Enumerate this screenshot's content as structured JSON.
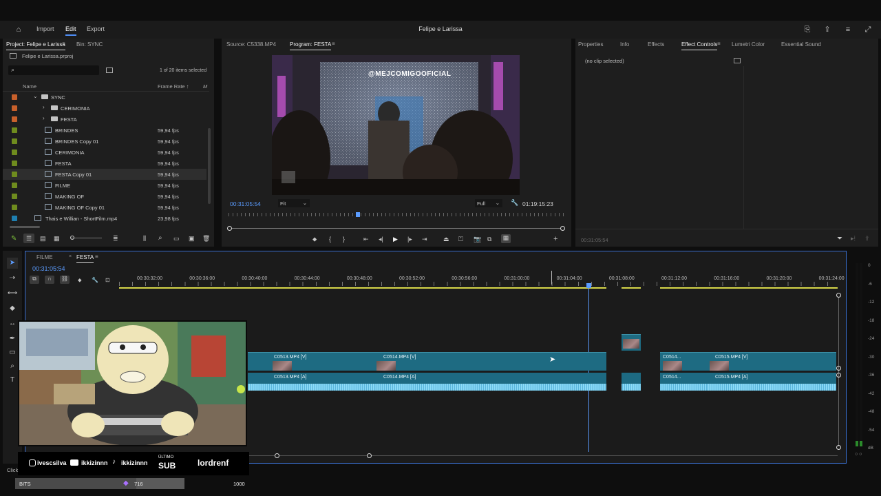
{
  "app": {
    "title": "Felipe e Larissa",
    "menu": [
      "Import",
      "Edit",
      "Export"
    ],
    "active_menu": "Edit"
  },
  "project": {
    "tabs": [
      "Project: Felipe e Larissa",
      "Bin: SYNC"
    ],
    "file": "Felipe e Larissa.prproj",
    "items_selected": "1 of 20 items selected",
    "col_name": "Name",
    "col_framerate": "Frame Rate",
    "col_more": "M",
    "rows": [
      {
        "label": "SYNC",
        "type": "folder",
        "indent": 1,
        "color": "#c8602b",
        "fps": ""
      },
      {
        "label": "CERIMONIA",
        "type": "folder",
        "indent": 2,
        "color": "#c8602b",
        "fps": ""
      },
      {
        "label": "FESTA",
        "type": "folder",
        "indent": 2,
        "color": "#c8602b",
        "fps": ""
      },
      {
        "label": "BRINDES",
        "type": "seq",
        "indent": 2,
        "color": "#6f8c1e",
        "fps": "59,94 fps"
      },
      {
        "label": "BRINDES Copy 01",
        "type": "seq",
        "indent": 2,
        "color": "#6f8c1e",
        "fps": "59,94 fps"
      },
      {
        "label": "CERIMONIA",
        "type": "seq",
        "indent": 2,
        "color": "#6f8c1e",
        "fps": "59,94 fps"
      },
      {
        "label": "FESTA",
        "type": "seq",
        "indent": 2,
        "color": "#6f8c1e",
        "fps": "59,94 fps"
      },
      {
        "label": "FESTA Copy 01",
        "type": "seq",
        "indent": 2,
        "color": "#6f8c1e",
        "fps": "59,94 fps",
        "selected": true
      },
      {
        "label": "FILME",
        "type": "seq",
        "indent": 2,
        "color": "#6f8c1e",
        "fps": "59,94 fps"
      },
      {
        "label": "MAKING OF",
        "type": "seq",
        "indent": 2,
        "color": "#6f8c1e",
        "fps": "59,94 fps"
      },
      {
        "label": "MAKING OF Copy 01",
        "type": "seq",
        "indent": 2,
        "color": "#6f8c1e",
        "fps": "59,94 fps"
      },
      {
        "label": "Thais e Willian - ShortFilm.mp4",
        "type": "clip",
        "indent": 1,
        "color": "#1f7fb0",
        "fps": "23,98 fps"
      }
    ]
  },
  "monitor": {
    "source_tab": "Source: C5338.MP4",
    "program_tab": "Program: FESTA",
    "current_time": "00:31:05:54",
    "fit": "Fit",
    "quality": "Full",
    "duration": "01:19:15:23",
    "overlay_text": "@MEJCOMIGOOFICIAL"
  },
  "effects": {
    "tabs": [
      "Properties",
      "Info",
      "Effects",
      "Effect Controls",
      "Lumetri Color",
      "Essential Sound"
    ],
    "active_tab": "Effect Controls",
    "no_clip": "(no clip selected)",
    "timecode": "00:31:05:54"
  },
  "timeline": {
    "tabs": [
      "FILME",
      "FESTA"
    ],
    "active_tab": "FESTA",
    "timecode": "00:31:05:54",
    "ruler": [
      "00:30:32:00",
      "00:30:36:00",
      "00:30:40:00",
      "00:30:44:00",
      "00:30:48:00",
      "00:30:52:00",
      "00:30:56:00",
      "00:31:00:00",
      "00:31:04:00",
      "00:31:08:00",
      "00:31:12:00",
      "00:31:16:00",
      "00:31:20:00",
      "00:31:24:00"
    ],
    "video_clips": [
      {
        "name": "C0513.MP4 [V]"
      },
      {
        "name": "C0514.MP4 [V]"
      },
      {
        "name": "C0514..."
      },
      {
        "name": "C0515.MP4 [V]"
      }
    ],
    "audio_clips": [
      {
        "name": "C0513.MP4 [A]"
      },
      {
        "name": "C0514.MP4 [A]"
      },
      {
        "name": "C0514..."
      },
      {
        "name": "C0515.MP4 [A]"
      }
    ]
  },
  "meter": {
    "labels": [
      "0",
      "-6",
      "-12",
      "-18",
      "-24",
      "-30",
      "-36",
      "-42",
      "-48",
      "-54",
      "dB"
    ]
  },
  "overlay": {
    "instagram": "ivescsilva",
    "youtube": "ikkizinnn",
    "tiktok": "ikkizinnn",
    "last_sub_label": "ÚLTIMO",
    "last_sub_title": "SUB",
    "last_sub_name": "lordrenf",
    "bits_label": "BITS",
    "bits_value": "716",
    "bits_goal": "1000",
    "status": "Click"
  }
}
